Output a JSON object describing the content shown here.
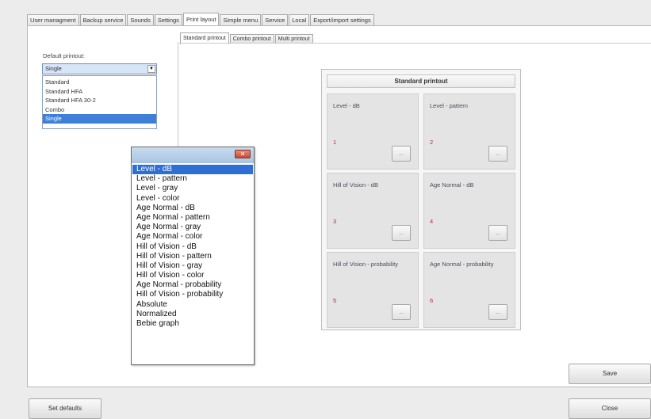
{
  "top_tabs": [
    "User managment",
    "Backup service",
    "Sounds",
    "Settings",
    "Print layout",
    "Simple menu",
    "Service",
    "Local",
    "Export/import settings"
  ],
  "active_top_tab": "Print layout",
  "default_printout": {
    "label": "Default printout:",
    "value": "Single",
    "options": [
      "Standard",
      "Standard HFA",
      "Standard HFA 30-2",
      "Combo",
      "Single"
    ],
    "selected": "Single"
  },
  "inner_tabs": [
    "Standard printout",
    "Combo printout",
    "Multi printout"
  ],
  "active_inner_tab": "Standard printout",
  "standard_printout": {
    "title": "Standard printout",
    "cells": [
      {
        "label": "Level - dB",
        "number": "1",
        "button": "..."
      },
      {
        "label": "Level - pattern",
        "number": "2",
        "button": "..."
      },
      {
        "label": "Hill of Vision - dB",
        "number": "3",
        "button": "..."
      },
      {
        "label": "Age Normal - dB",
        "number": "4",
        "button": "..."
      },
      {
        "label": "Hill of Vision - probability",
        "number": "5",
        "button": "..."
      },
      {
        "label": "Age Normal - probability",
        "number": "6",
        "button": "..."
      }
    ]
  },
  "popup": {
    "close_glyph": "✕",
    "items": [
      "Level - dB",
      "Level - pattern",
      "Level - gray",
      "Level - color",
      "Age Normal - dB",
      "Age Normal - pattern",
      "Age Normal - gray",
      "Age Normal - color",
      "Hill of Vision - dB",
      "Hill of Vision - pattern",
      "Hill of Vision - gray",
      "Hill of Vision - color",
      "Age Normal - probability",
      "Hill of Vision - probability",
      "Absolute",
      "Normalized",
      "Bebie graph"
    ],
    "selected": "Level - dB"
  },
  "buttons": {
    "save": "Save",
    "set_defaults": "Set defaults",
    "close": "Close"
  },
  "colors": {
    "selection": "#2e6fd6",
    "cell_number": "#c1272d",
    "close_button": "#c94a33"
  }
}
